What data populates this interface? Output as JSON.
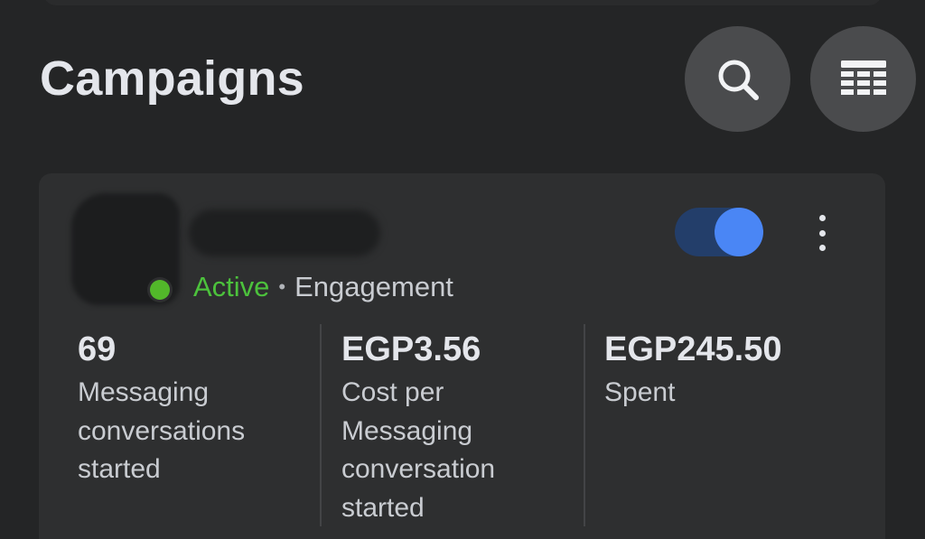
{
  "header": {
    "title": "Campaigns",
    "search_icon": "search-icon",
    "columns_icon": "table-columns-icon"
  },
  "campaign": {
    "name": "",
    "status": "Active",
    "separator": "•",
    "objective": "Engagement",
    "enabled": true,
    "toggle_color_on": "#4a86f5",
    "status_color": "#52b82a",
    "metrics": [
      {
        "value": "69",
        "label": "Messaging conversations started"
      },
      {
        "value": "EGP3.56",
        "label": "Cost per Messaging conversation started"
      },
      {
        "value": "EGP245.50",
        "label": "Spent"
      }
    ]
  }
}
